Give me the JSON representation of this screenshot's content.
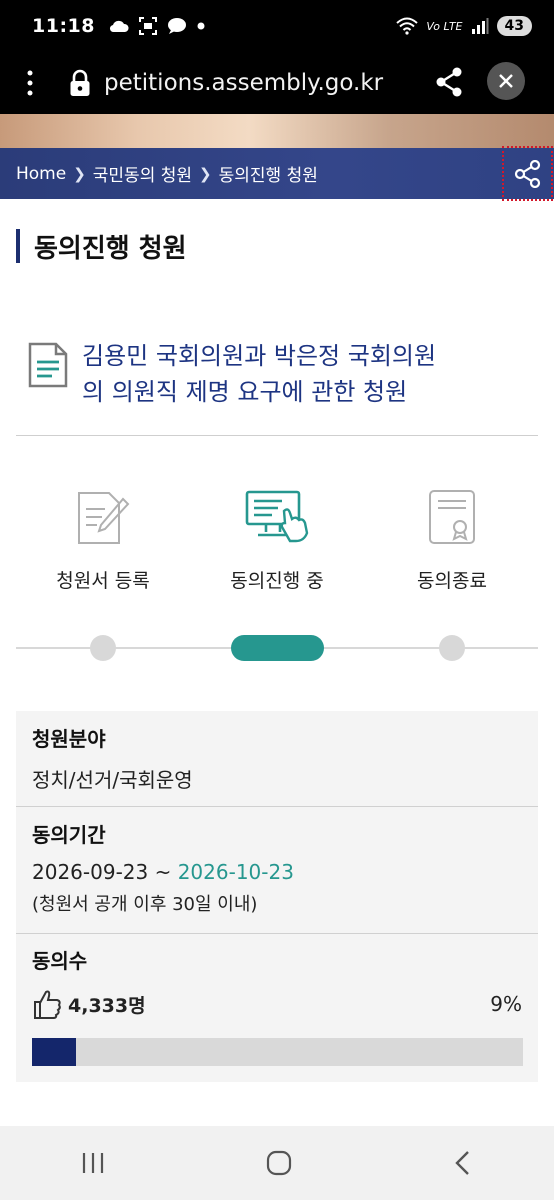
{
  "status": {
    "time": "11:18",
    "network": "Vo LTE",
    "battery": "43"
  },
  "browser": {
    "url": "petitions.assembly.go.kr"
  },
  "breadcrumb": {
    "home": "Home",
    "item1": "국민동의 청원",
    "item2": "동의진행 청원"
  },
  "page": {
    "title": "동의진행 청원"
  },
  "petition": {
    "title_line1": "김용민 국회의원과 박은정 국회의원",
    "title_line2": "의 의원직 제명 요구에 관한 청원"
  },
  "steps": [
    {
      "label": "청원서 등록",
      "icon": "document-pen-icon",
      "active": false
    },
    {
      "label": "동의진행 중",
      "icon": "computer-hand-icon",
      "active": true
    },
    {
      "label": "동의종료",
      "icon": "certificate-icon",
      "active": false
    }
  ],
  "info": {
    "field_label": "청원분야",
    "field_value": "정치/선거/국회운영",
    "period_label": "동의기간",
    "period_start": "2026-09-23 ~ ",
    "period_end": "2026-10-23",
    "period_note": "(청원서 공개 이후 30일 이내)",
    "count_label": "동의수",
    "count_value": "4,333명",
    "percent_text": "9%",
    "progress_fraction": 0.09
  },
  "colors": {
    "accent": "#26978f",
    "navy": "#14266b",
    "title_blue": "#1d3482"
  }
}
